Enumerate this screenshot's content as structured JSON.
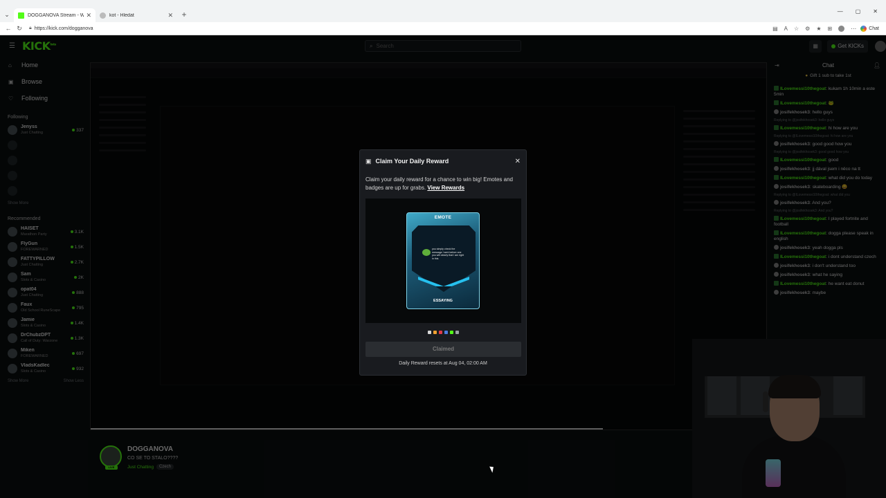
{
  "browser": {
    "tabs": [
      {
        "title": "DOGGANOVA Stream - Watch Live",
        "active": true
      },
      {
        "title": "kot - Hledat",
        "active": false
      }
    ],
    "url": "https://kick.com/dogganova",
    "chat_label": "Chat"
  },
  "header": {
    "logo": "KICK",
    "logo_sup": "beta",
    "search_placeholder": "Search",
    "get_kicks": "Get KICKs"
  },
  "sidebar": {
    "nav": [
      {
        "label": "Home",
        "icon": "home-icon"
      },
      {
        "label": "Browse",
        "icon": "browse-icon"
      },
      {
        "label": "Following",
        "icon": "heart-icon"
      }
    ],
    "following_title": "Following",
    "following": [
      {
        "name": "Jenyss",
        "category": "Just Chatting",
        "viewers": "337"
      }
    ],
    "show_more": "Show More",
    "recommended_title": "Recommended",
    "recommended": [
      {
        "name": "HAISET",
        "category": "Marathon Party",
        "viewers": "3.1K"
      },
      {
        "name": "FlyGun",
        "category": "FOREWARNED",
        "viewers": "1.5K"
      },
      {
        "name": "FATTYPILLOW",
        "category": "Just Chatting",
        "viewers": "2.7K"
      },
      {
        "name": "Sam",
        "category": "Slots & Casino",
        "viewers": "2K"
      },
      {
        "name": "opat04",
        "category": "Just Chatting",
        "viewers": "888"
      },
      {
        "name": "Faux",
        "category": "Old School RuneScape",
        "viewers": "795"
      },
      {
        "name": "Jamie",
        "category": "Slots & Casino",
        "viewers": "1.4K"
      },
      {
        "name": "DrChubzDPT",
        "category": "Call of Duty: Warzone",
        "viewers": "1.3K"
      },
      {
        "name": "Miken",
        "category": "FOREWARNED",
        "viewers": "697"
      },
      {
        "name": "VladsKadlec",
        "category": "Slots & Casino",
        "viewers": "932"
      }
    ],
    "show_more_bottom": "Show More",
    "show_less": "Show Less"
  },
  "stream_info": {
    "channel": "DOGGANOVA",
    "title": "CO SE TO STALO????",
    "category": "Just Chatting",
    "tag": "Czech",
    "live": "LIVE"
  },
  "chat": {
    "title": "Chat",
    "gift_text": "Gift 1 sub to take 1st",
    "messages": [
      {
        "user": "ILovemessi10thegoat",
        "text": "kukam 1h 10min a este 5min",
        "reply": "",
        "color": "green"
      },
      {
        "user": "ILovemessi10thegoat",
        "text": "🐸",
        "reply": "",
        "color": "green"
      },
      {
        "user": "josifekhosek3",
        "text": "hello guys",
        "reply": "",
        "color": "gray"
      },
      {
        "user": "ILovemessi10thegoat",
        "text": "hi how are you",
        "reply": "Replying to @josifekhosek3: hello guys",
        "color": "green"
      },
      {
        "user": "josifekhosek3",
        "text": "good good how you",
        "reply": "Replying to @ILovemessi10thegoat: hi how are you",
        "color": "gray"
      },
      {
        "user": "ILovemessi10thegoat",
        "text": "good",
        "reply": "Replying to @josifekhosek3: good good how you",
        "color": "green"
      },
      {
        "user": "josifekhosek3",
        "text": "jj dával jsem i něco na tt",
        "reply": "",
        "color": "gray"
      },
      {
        "user": "ILovemessi10thegoat",
        "text": "what did you do today",
        "reply": "",
        "color": "green"
      },
      {
        "user": "josifekhosek3",
        "text": "skateboarding 😀",
        "reply": "",
        "color": "gray"
      },
      {
        "user": "josifekhosek3",
        "text": "And you?",
        "reply": "Replying to @ILovemessi10thegoat: what did you",
        "color": "gray"
      },
      {
        "user": "ILovemessi10thegoat",
        "text": "I played fortnite and football",
        "reply": "Replying to @josifekhosek3: And you?",
        "color": "green"
      },
      {
        "user": "ILovemessi10thegoat",
        "text": "dogga please speak in english",
        "reply": "",
        "color": "green"
      },
      {
        "user": "josifekhosek3",
        "text": "yeah dogga pls",
        "reply": "",
        "color": "gray"
      },
      {
        "user": "ILovemessi10thegoat",
        "text": "i dont understand czech",
        "reply": "",
        "color": "green"
      },
      {
        "user": "josifekhosek3",
        "text": "i don't understand too",
        "reply": "",
        "color": "gray"
      },
      {
        "user": "josifekhosek3",
        "text": "what he saying",
        "reply": "",
        "color": "gray"
      },
      {
        "user": "ILovemessi10thegoat",
        "text": "he want eat donut",
        "reply": "",
        "color": "green"
      },
      {
        "user": "josifekhosek3",
        "text": "maybe",
        "reply": "",
        "color": "gray"
      }
    ]
  },
  "modal": {
    "title": "Claim Your Daily Reward",
    "desc_prefix": "Claim your daily reward for a chance to win big! Emotes and badges are up for grabs. ",
    "view_rewards": "View Rewards",
    "card_type": "EMOTE",
    "card_name": "ESSAYING",
    "card_text": "you simply check the message I sent before one you will clearly that I am right in this",
    "swatch_colors": [
      "#d8d8d8",
      "#f0a030",
      "#e03a4a",
      "#4d7de0",
      "#53fc18",
      "#9aa0a6"
    ],
    "claimed_label": "Claimed",
    "resets_text": "Daily Reward resets at Aug 04, 02:00 AM"
  },
  "colors": {
    "accent": "#53fc18",
    "background": "#0b0e0f",
    "modal_bg": "#191b1f"
  }
}
